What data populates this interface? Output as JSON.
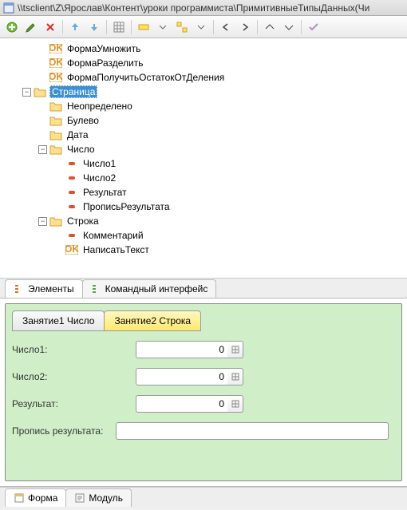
{
  "titlebar": {
    "path": "\\\\tsclient\\Z\\Ярослав\\Контент\\уроки программиста\\ПримитивныеТипыДанных(Чи"
  },
  "tree": {
    "items": [
      {
        "indent": 2,
        "twisty": "",
        "icon": "ok",
        "label": "ФормаУмножить",
        "sel": false
      },
      {
        "indent": 2,
        "twisty": "",
        "icon": "ok",
        "label": "ФормаРазделить",
        "sel": false
      },
      {
        "indent": 2,
        "twisty": "",
        "icon": "ok",
        "label": "ФормаПолучитьОстатокОтДеления",
        "sel": false
      },
      {
        "indent": 1,
        "twisty": "-",
        "icon": "folder",
        "label": "Страница",
        "sel": true
      },
      {
        "indent": 2,
        "twisty": "",
        "icon": "folder",
        "label": "Неопределено",
        "sel": false
      },
      {
        "indent": 2,
        "twisty": "",
        "icon": "folder",
        "label": "Булево",
        "sel": false
      },
      {
        "indent": 2,
        "twisty": "",
        "icon": "folder",
        "label": "Дата",
        "sel": false
      },
      {
        "indent": 2,
        "twisty": "-",
        "icon": "folder",
        "label": "Число",
        "sel": false
      },
      {
        "indent": 3,
        "twisty": "",
        "icon": "attr",
        "label": "Число1",
        "sel": false
      },
      {
        "indent": 3,
        "twisty": "",
        "icon": "attr",
        "label": "Число2",
        "sel": false
      },
      {
        "indent": 3,
        "twisty": "",
        "icon": "attr",
        "label": "Результат",
        "sel": false
      },
      {
        "indent": 3,
        "twisty": "",
        "icon": "attr",
        "label": "ПрописьРезультата",
        "sel": false
      },
      {
        "indent": 2,
        "twisty": "-",
        "icon": "folder",
        "label": "Строка",
        "sel": false
      },
      {
        "indent": 3,
        "twisty": "",
        "icon": "attr",
        "label": "Комментарий",
        "sel": false
      },
      {
        "indent": 3,
        "twisty": "",
        "icon": "ok",
        "label": "НаписатьТекст",
        "sel": false
      }
    ]
  },
  "midtabs": {
    "elements": "Элементы",
    "cmd": "Командный интерфейс"
  },
  "preview": {
    "tab1": "Занятие1 Число",
    "tab2": "Занятие2 Строка",
    "row1": "Число1:",
    "row2": "Число2:",
    "row3": "Результат:",
    "row4": "Пропись результата:",
    "val1": "0",
    "val2": "0",
    "val3": "0"
  },
  "bottomtabs": {
    "form": "Форма",
    "module": "Модуль"
  }
}
